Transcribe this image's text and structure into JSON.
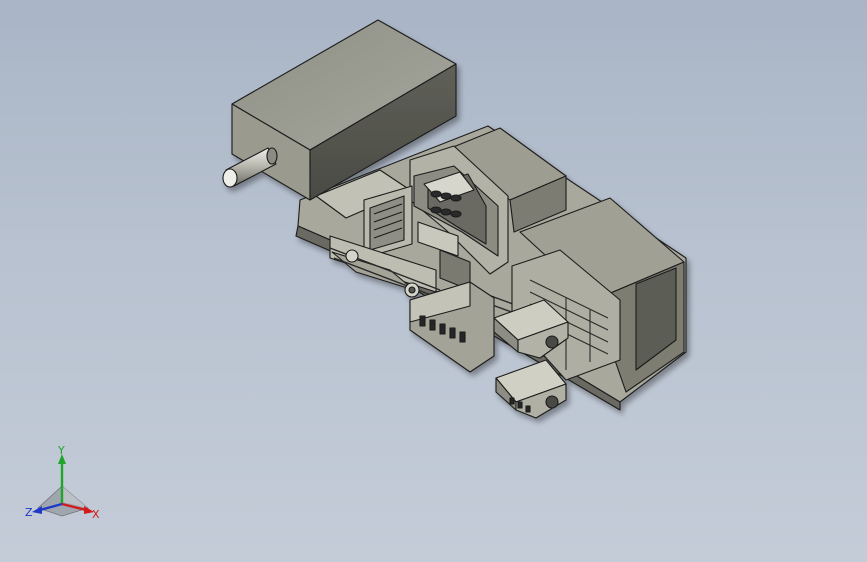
{
  "viewport": {
    "background_top": "#a9b5c6",
    "background_bottom": "#c4ccd8"
  },
  "model": {
    "body_color": "#9a9a8e",
    "outline_color": "#1c1c1c"
  },
  "triad": {
    "x_label": "X",
    "y_label": "Y",
    "z_label": "Z",
    "x_color": "#d11b1b",
    "y_color": "#1fa52a",
    "z_color": "#2038c8"
  }
}
